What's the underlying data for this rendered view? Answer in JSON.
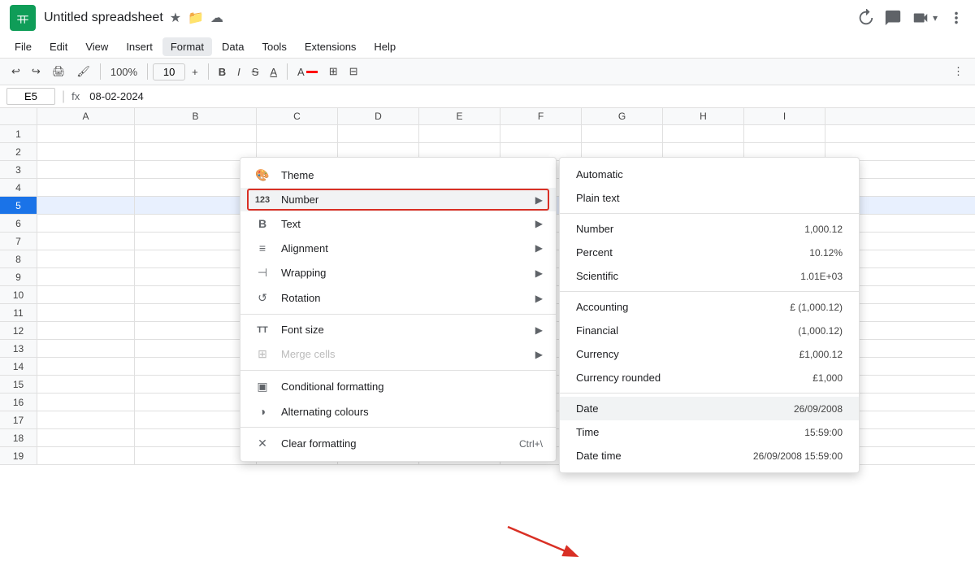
{
  "app": {
    "icon_color": "#0f9d58",
    "title": "Untitled spreadsheet",
    "title_icons": [
      "★",
      "📁",
      "☁"
    ]
  },
  "top_right": {
    "buttons": [
      "history",
      "comment",
      "video",
      "more"
    ]
  },
  "menu_bar": {
    "items": [
      "File",
      "Edit",
      "View",
      "Insert",
      "Format",
      "Data",
      "Tools",
      "Extensions",
      "Help"
    ]
  },
  "toolbar": {
    "zoom": "100%",
    "font_size": "10",
    "buttons": [
      "undo",
      "redo",
      "print",
      "paint-format",
      "bold",
      "italic",
      "strikethrough",
      "underline",
      "fill-color",
      "borders",
      "merge"
    ]
  },
  "formula_bar": {
    "cell_ref": "E5",
    "fx_label": "fx",
    "formula_value": "08-02-2024"
  },
  "spreadsheet": {
    "col_headers": [
      "",
      "A",
      "B",
      "C",
      "D",
      "E",
      "F",
      "G",
      "H",
      "I"
    ],
    "rows": [
      1,
      2,
      3,
      4,
      5,
      6,
      7,
      8,
      9,
      10,
      11,
      12,
      13,
      14,
      15,
      16,
      17,
      18,
      19
    ],
    "selected_row": 5
  },
  "format_menu": {
    "title": "Format",
    "items": [
      {
        "id": "theme",
        "icon": "🎨",
        "label": "Theme",
        "has_arrow": false
      },
      {
        "id": "number",
        "icon": "123",
        "label": "Number",
        "has_arrow": true,
        "highlighted": true
      },
      {
        "id": "text",
        "icon": "B",
        "label": "Text",
        "has_arrow": true
      },
      {
        "id": "alignment",
        "icon": "≡",
        "label": "Alignment",
        "has_arrow": true
      },
      {
        "id": "wrapping",
        "icon": "⊣",
        "label": "Wrapping",
        "has_arrow": true
      },
      {
        "id": "rotation",
        "icon": "↺",
        "label": "Rotation",
        "has_arrow": true
      },
      {
        "id": "divider1",
        "type": "divider"
      },
      {
        "id": "font-size",
        "icon": "TT",
        "label": "Font size",
        "has_arrow": true
      },
      {
        "id": "merge-cells",
        "icon": "⊞",
        "label": "Merge cells",
        "has_arrow": true,
        "disabled": true
      },
      {
        "id": "divider2",
        "type": "divider"
      },
      {
        "id": "conditional",
        "icon": "▣",
        "label": "Conditional formatting",
        "has_arrow": false
      },
      {
        "id": "alternating",
        "icon": "◑",
        "label": "Alternating colours",
        "has_arrow": false
      },
      {
        "id": "divider3",
        "type": "divider"
      },
      {
        "id": "clear",
        "icon": "✕",
        "label": "Clear formatting",
        "shortcut": "Ctrl+\\",
        "has_arrow": false
      }
    ]
  },
  "number_submenu": {
    "items": [
      {
        "id": "automatic",
        "label": "Automatic",
        "value": "",
        "type": "plain"
      },
      {
        "id": "plain-text",
        "label": "Plain text",
        "value": "",
        "type": "plain"
      },
      {
        "id": "divider1",
        "type": "divider"
      },
      {
        "id": "number",
        "label": "Number",
        "value": "1,000.12"
      },
      {
        "id": "percent",
        "label": "Percent",
        "value": "10.12%"
      },
      {
        "id": "scientific",
        "label": "Scientific",
        "value": "1.01E+03"
      },
      {
        "id": "divider2",
        "type": "divider"
      },
      {
        "id": "accounting",
        "label": "Accounting",
        "value": "£ (1,000.12)"
      },
      {
        "id": "financial",
        "label": "Financial",
        "value": "(1,000.12)"
      },
      {
        "id": "currency",
        "label": "Currency",
        "value": "£1,000.12"
      },
      {
        "id": "currency-rounded",
        "label": "Currency rounded",
        "value": "£1,000"
      },
      {
        "id": "divider3",
        "type": "divider"
      },
      {
        "id": "date",
        "label": "Date",
        "value": "26/09/2008"
      },
      {
        "id": "time",
        "label": "Time",
        "value": "15:59:00"
      },
      {
        "id": "datetime",
        "label": "Date time",
        "value": "26/09/2008 15:59:00"
      }
    ]
  },
  "arrow": {
    "label": "Date arrow annotation"
  }
}
